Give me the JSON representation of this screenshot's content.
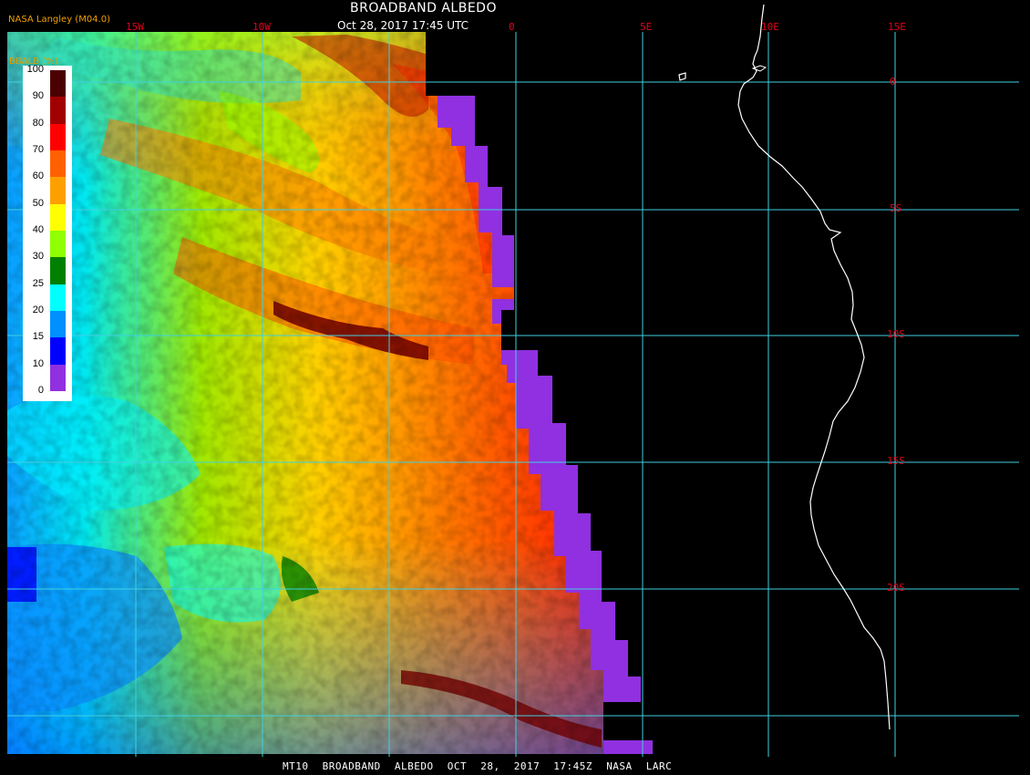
{
  "header": {
    "title": "BROADBAND ALBEDO",
    "subtitle": "Oct 28, 2017 17:45 UTC",
    "org": "NASA Langley (M04.0)"
  },
  "footer": {
    "product": "MT10",
    "name": "BROADBAND ALBEDO",
    "datetime": "OCT 28, 2017 17:45Z",
    "source": "NASA LARC"
  },
  "map": {
    "lon_labels": [
      "15W",
      "10W",
      "0",
      "5E",
      "10E",
      "15E"
    ],
    "lat_labels": [
      "0",
      "5S",
      "10S",
      "15S",
      "20S"
    ],
    "grid_color": "#40d0e0",
    "coast_color": "#ffffff"
  },
  "legend": {
    "title": "BBALB (%)",
    "ticks": [
      "100",
      "90",
      "80",
      "70",
      "60",
      "50",
      "40",
      "30",
      "25",
      "20",
      "15",
      "10",
      "0"
    ],
    "colors": [
      "#4a0000",
      "#a00000",
      "#ff0000",
      "#ff6000",
      "#ffa000",
      "#ffff00",
      "#90ff00",
      "#008000",
      "#00ffff",
      "#0090ff",
      "#0000ff",
      "#9030e0"
    ]
  }
}
